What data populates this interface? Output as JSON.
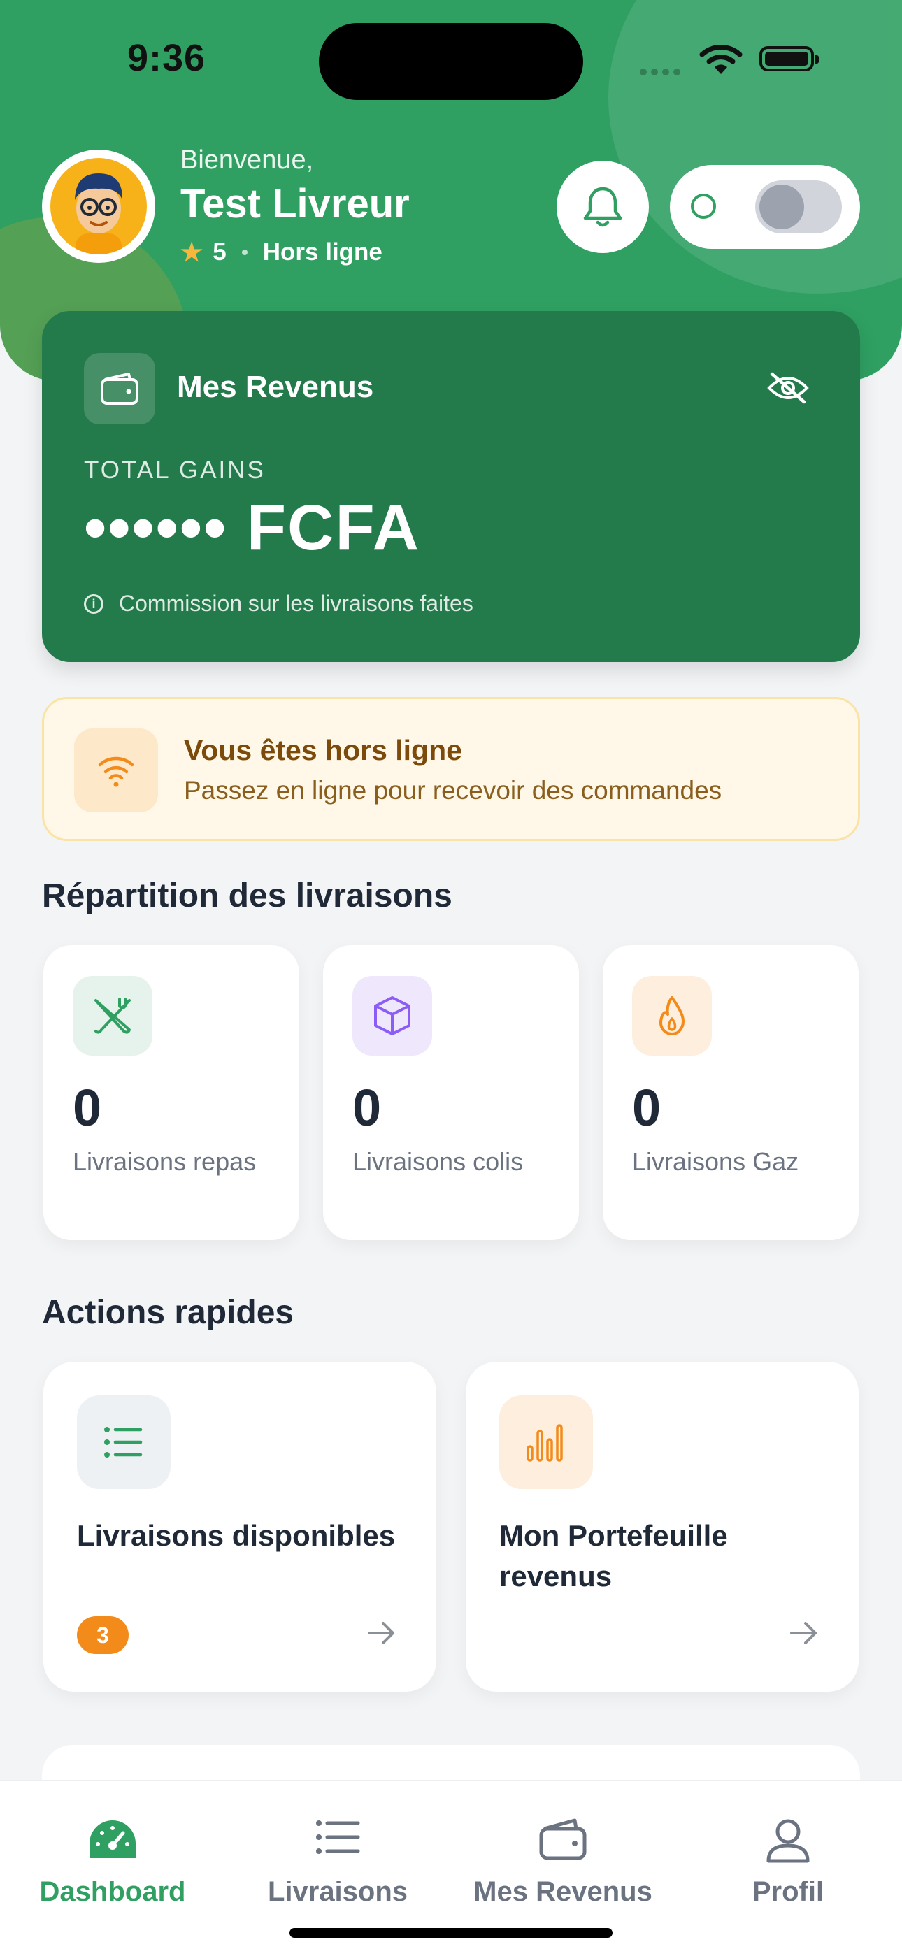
{
  "status_bar": {
    "time": "9:36"
  },
  "header": {
    "welcome": "Bienvenue,",
    "user_name": "Test Livreur",
    "rating": "5",
    "status": "Hors ligne",
    "online_toggle": "off"
  },
  "revenue_card": {
    "title": "Mes Revenus",
    "total_label": "TOTAL GAINS",
    "amount": "•••••• FCFA",
    "note": "Commission sur les livraisons faites"
  },
  "offline_banner": {
    "title": "Vous êtes hors ligne",
    "message": "Passez en ligne pour recevoir des commandes"
  },
  "breakdown": {
    "title": "Répartition des livraisons",
    "items": [
      {
        "icon": "fork-knife-icon",
        "value": "0",
        "label": "Livraisons repas"
      },
      {
        "icon": "box-icon",
        "value": "0",
        "label": "Livraisons colis"
      },
      {
        "icon": "flame-icon",
        "value": "0",
        "label": "Livraisons Gaz"
      }
    ]
  },
  "quick_actions": {
    "title": "Actions rapides",
    "items": [
      {
        "icon": "list-icon",
        "label": "Livraisons disponibles",
        "badge": "3"
      },
      {
        "icon": "bar-chart-icon",
        "label": "Mon Portefeuille revenus"
      }
    ]
  },
  "tabbar": {
    "items": [
      {
        "icon": "dashboard-gauge-icon",
        "label": "Dashboard",
        "active": true
      },
      {
        "icon": "list-icon",
        "label": "Livraisons"
      },
      {
        "icon": "wallet-icon",
        "label": "Mes Revenus"
      },
      {
        "icon": "person-icon",
        "label": "Profil"
      }
    ]
  },
  "colors": {
    "brand_green": "#2fa062",
    "card_green": "#237a4b",
    "accent_orange": "#f38b1a",
    "purple": "#8b5cf6"
  }
}
